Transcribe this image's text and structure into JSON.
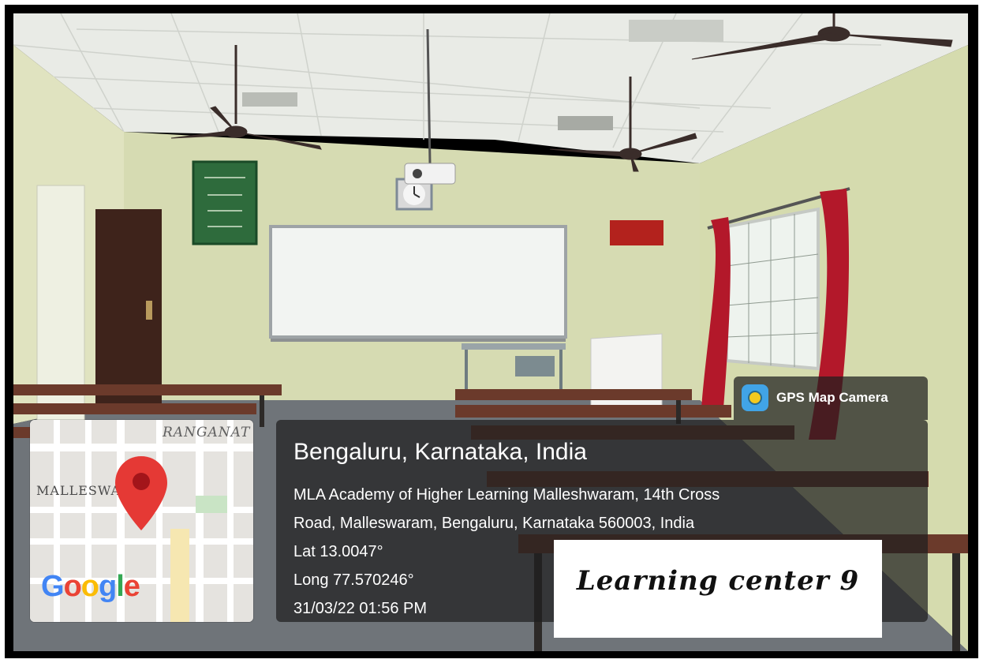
{
  "overlay": {
    "app_badge": "GPS Map Camera",
    "location_title": "Bengaluru, Karnataka, India",
    "address_line_1": "MLA Academy of Higher Learning Malleshwaram, 14th Cross",
    "address_line_2": "Road, Malleswaram, Bengaluru, Karnataka 560003, India",
    "latitude": "Lat 13.0047°",
    "longitude": "Long 77.570246°",
    "timestamp": "31/03/22 01:56 PM"
  },
  "map": {
    "label_top": "RANGANAT",
    "label_left": "MALLESWA",
    "logo": {
      "letters": [
        "G",
        "o",
        "o",
        "g",
        "l",
        "e"
      ],
      "colors": [
        "#4285F4",
        "#EA4335",
        "#FBBC05",
        "#4285F4",
        "#34A853",
        "#EA4335"
      ]
    },
    "pin_color": "#e53935"
  },
  "caption": "Learning center 9",
  "colors": {
    "wall": "#d8dcb4",
    "ceiling": "#e9ebe6",
    "curtain": "#b3182a",
    "overlay_panel": "#1e1e1e"
  },
  "icons": [
    "map-pin-icon",
    "gps-map-camera-icon"
  ]
}
